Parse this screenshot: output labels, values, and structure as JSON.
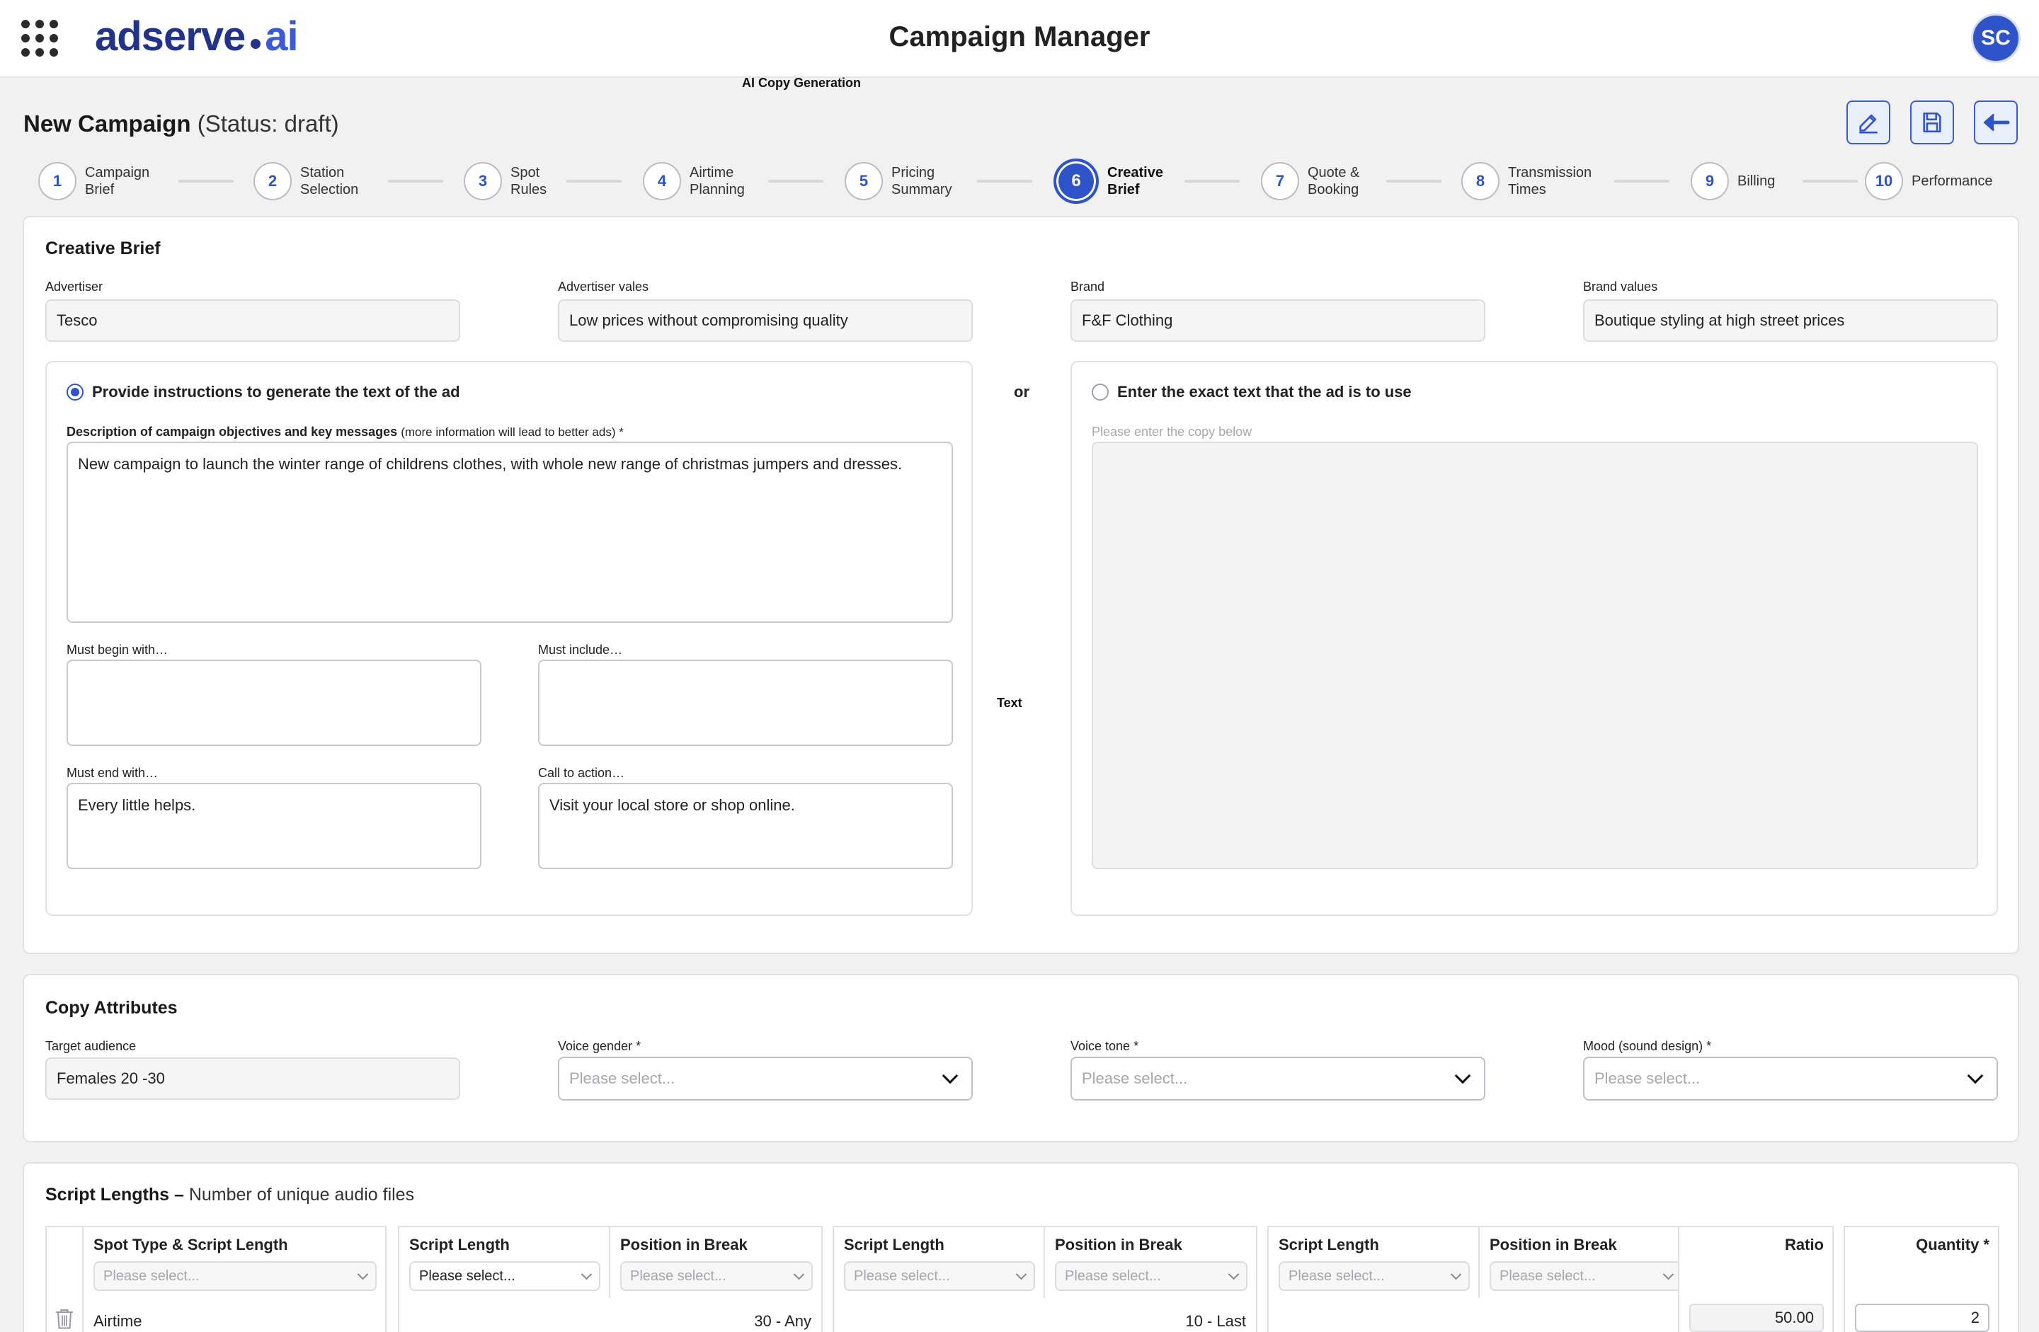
{
  "header": {
    "logo_main": "adserve",
    "logo_suffix": "ai",
    "app_title": "Campaign Manager",
    "avatar_initials": "SC",
    "accent_color": "#2f53c9"
  },
  "ai_copy_label": "AI Copy Generation",
  "page": {
    "title": "New Campaign",
    "status": "(Status: draft)"
  },
  "toolbar": {
    "edit_icon": "pencil-icon",
    "save_icon": "floppy-disk-icon",
    "back_icon": "arrow-left-icon"
  },
  "steps": [
    {
      "num": "1",
      "label": "Campaign\nBrief"
    },
    {
      "num": "2",
      "label": "Station\nSelection"
    },
    {
      "num": "3",
      "label": "Spot\nRules"
    },
    {
      "num": "4",
      "label": "Airtime\nPlanning"
    },
    {
      "num": "5",
      "label": "Pricing\nSummary"
    },
    {
      "num": "6",
      "label": "Creative\nBrief"
    },
    {
      "num": "7",
      "label": "Quote &\nBooking"
    },
    {
      "num": "8",
      "label": "Transmission\nTimes"
    },
    {
      "num": "9",
      "label": "Billing"
    },
    {
      "num": "10",
      "label": "Performance"
    }
  ],
  "creative_brief": {
    "title": "Creative Brief",
    "advertiser_label": "Advertiser",
    "advertiser_value": "Tesco",
    "advertiser_values_label": "Advertiser vales",
    "advertiser_values_value": "Low prices without compromising quality",
    "brand_label": "Brand",
    "brand_value": "F&F Clothing",
    "brand_values_label": "Brand values",
    "brand_values_value": "Boutique styling at high street prices",
    "or_label": "or",
    "text_label": "Text",
    "instructions": {
      "radio_label": "Provide instructions to generate the text of the ad",
      "description_label": "Description of campaign objectives and key messages",
      "description_hint": "(more information will lead to better ads) *",
      "description_value": "New campaign to launch the winter range of childrens clothes, with  whole new range of christmas jumpers and dresses.",
      "must_begin_label": "Must begin with…",
      "must_begin_value": "",
      "must_include_label": "Must include…",
      "must_include_value": "",
      "must_end_label": "Must end with…",
      "must_end_value": "Every little helps.",
      "cta_label": "Call to action…",
      "cta_value": "Visit your local store or shop online."
    },
    "exact_text": {
      "radio_label": "Enter the exact text that the ad is to use",
      "copy_label": "Please enter the copy below",
      "copy_value": ""
    }
  },
  "copy_attributes": {
    "title": "Copy Attributes",
    "target_audience_label": "Target audience",
    "target_audience_value": "Females 20 -30",
    "voice_gender_label": "Voice gender *",
    "voice_tone_label": "Voice tone *",
    "mood_label": "Mood (sound design) *",
    "placeholder": "Please select..."
  },
  "script_lengths": {
    "title": "Script Lengths –",
    "subtitle": "Number of unique audio files",
    "headers": {
      "spot_type": "Spot Type & Script Length",
      "script_length": "Script Length",
      "position": "Position in Break",
      "ratio": "Ratio",
      "quantity": "Quantity *"
    },
    "placeholder": "Please select...",
    "row": {
      "spot_type": "Airtime",
      "script_length_1": "30 - Any",
      "position_1": "10 - Last",
      "ratio": "50.00",
      "quantity": "2"
    }
  }
}
